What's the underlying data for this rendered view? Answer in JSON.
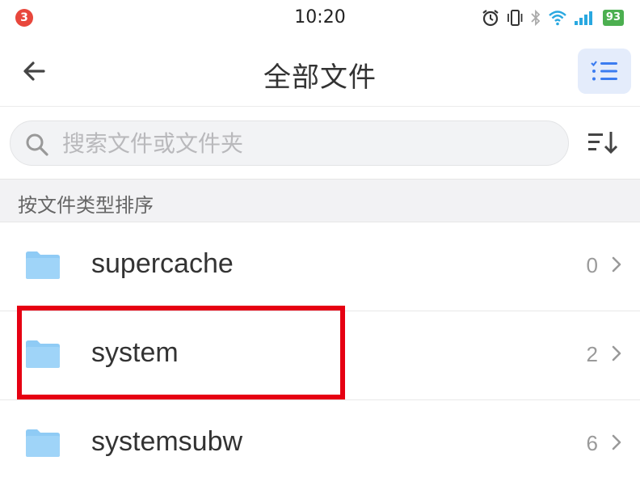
{
  "status_bar": {
    "notification_count": "3",
    "time": "10:20",
    "battery": "93"
  },
  "nav": {
    "title": "全部文件"
  },
  "search": {
    "placeholder": "搜索文件或文件夹",
    "value": ""
  },
  "section": {
    "label": "按文件类型排序"
  },
  "files": [
    {
      "name": "supercache",
      "count": "0"
    },
    {
      "name": "system",
      "count": "2"
    },
    {
      "name": "systemsubw",
      "count": "6"
    }
  ],
  "colors": {
    "accent": "#3b7cf0",
    "folder": "#8fcbf5",
    "highlight": "#e60012"
  }
}
